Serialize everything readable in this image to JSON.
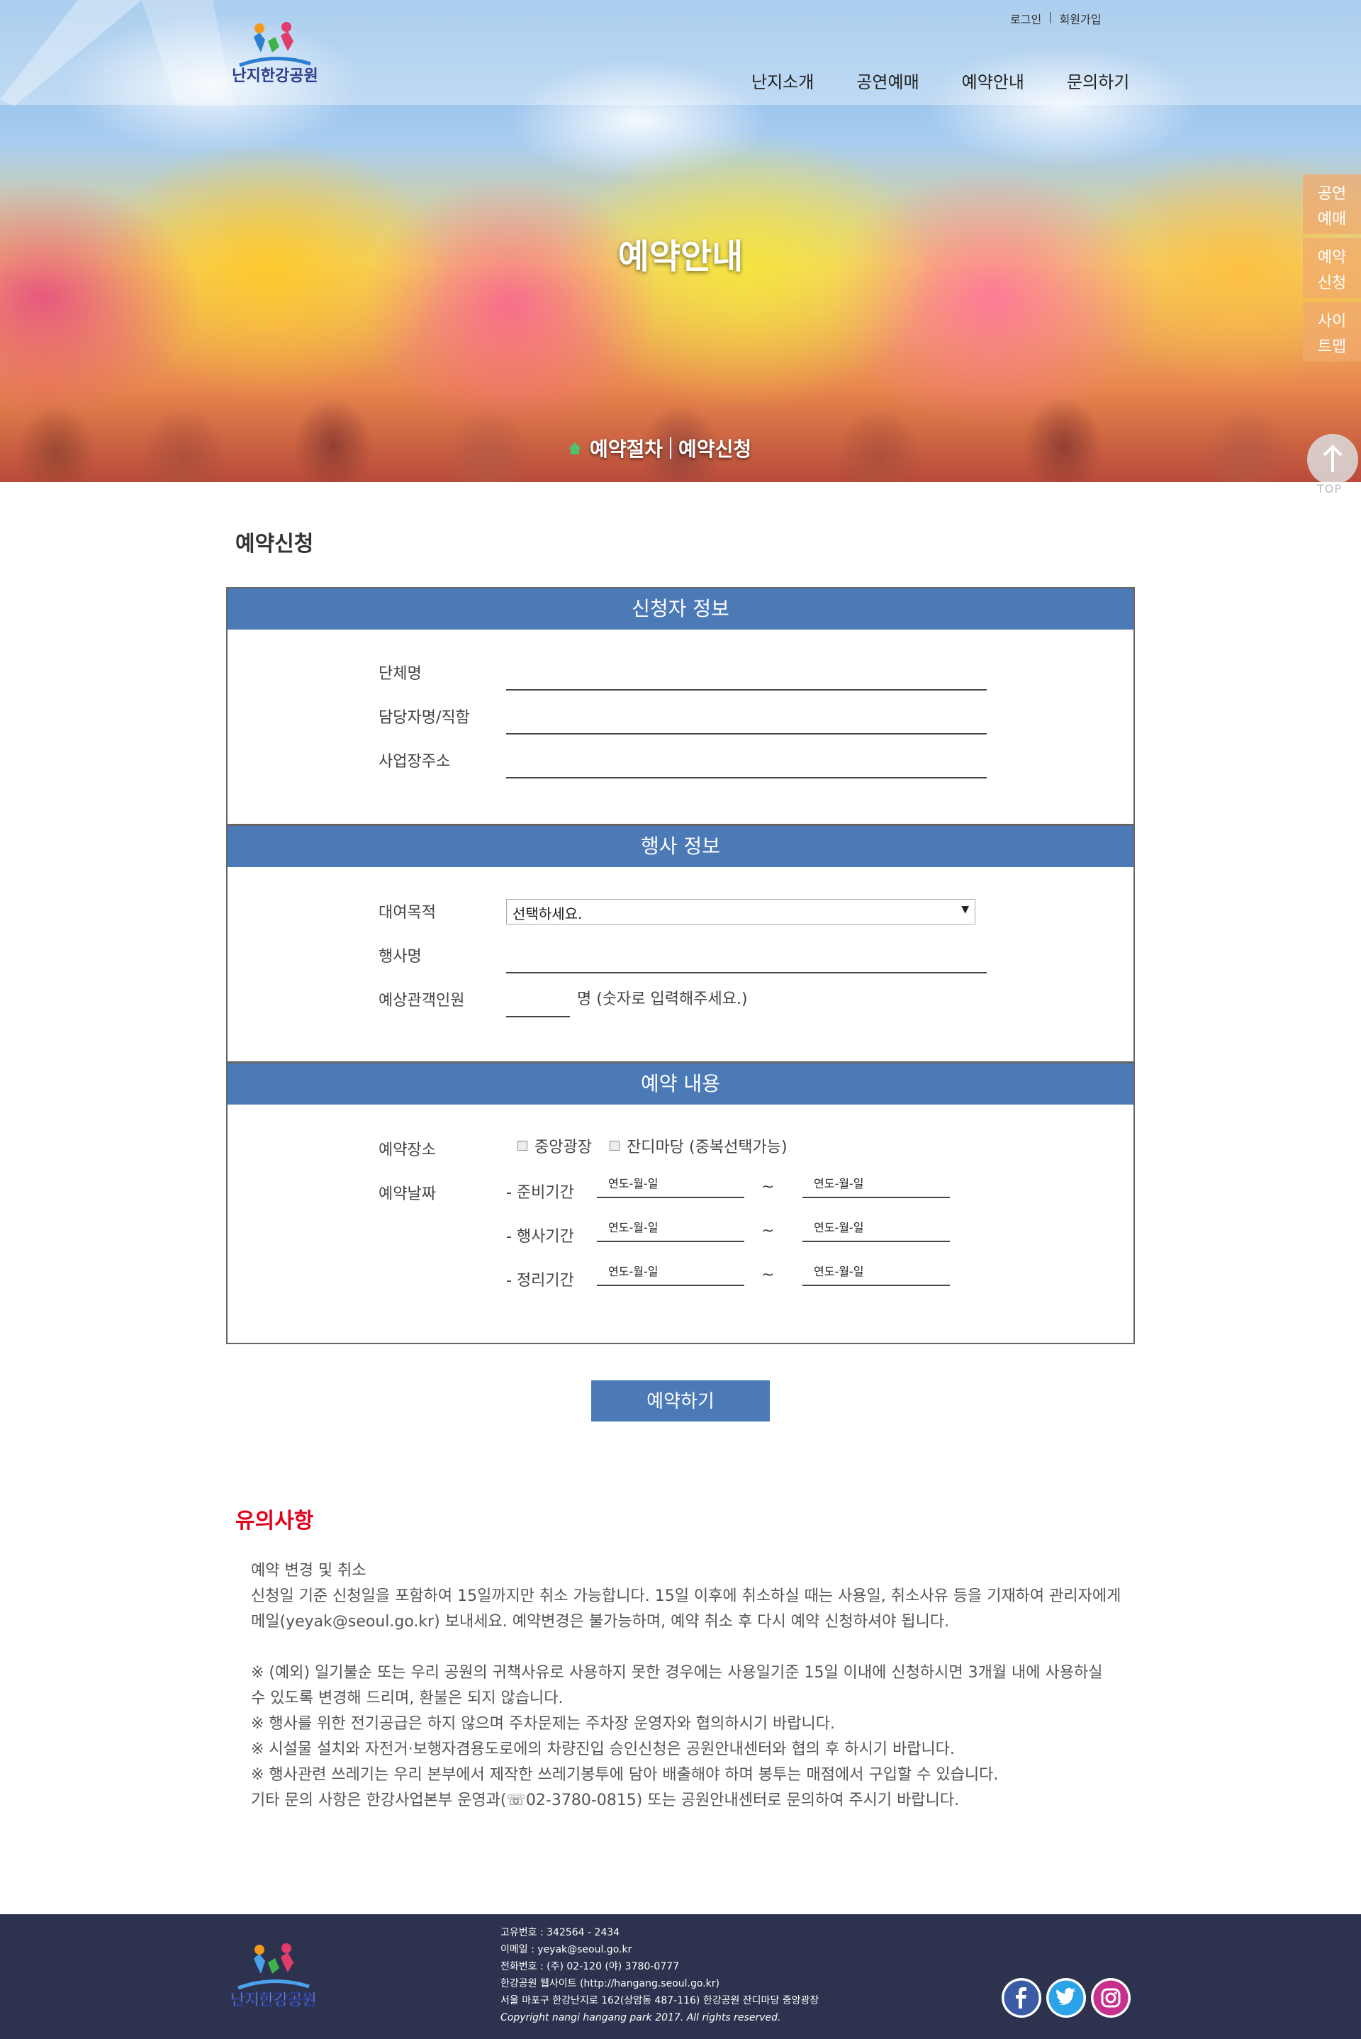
{
  "header": {
    "logo_alt": "난지한강공원",
    "util": {
      "login": "로그인",
      "sep": "|",
      "signup": "회원가입"
    },
    "nav": [
      "난지소개",
      "공연예매",
      "예약안내",
      "문의하기"
    ],
    "hero_title": "예약안내",
    "sub_tabs": {
      "first": "예약절차",
      "second": "예약신청"
    },
    "quick_links": [
      {
        "line1": "공연",
        "line2": "예매"
      },
      {
        "line1": "예약",
        "line2": "신청"
      },
      {
        "line1": "사이",
        "line2": "트맵"
      }
    ],
    "top_label": "TOP"
  },
  "page": {
    "heading": "예약신청",
    "sections": {
      "applicant": {
        "title": "신청자 정보",
        "fields": [
          "단체명",
          "담당자명/직함",
          "사업장주소"
        ]
      },
      "event": {
        "title": "행사 정보",
        "purpose_label": "대여목적",
        "purpose_value": "선택하세요.",
        "name_label": "행사명",
        "audience_label": "예상관객인원",
        "audience_suffix": "명 (숫자로 입력해주세요.)"
      },
      "reservation": {
        "title": "예약 내용",
        "place_label": "예약장소",
        "place_options": [
          "중앙광장",
          "잔디마당 (중복선택가능)"
        ],
        "date_label": "예약날짜",
        "periods": [
          "- 준비기간",
          "- 행사기간",
          "- 정리기간"
        ],
        "date_placeholder": "연도-월-일",
        "tilde": "~"
      }
    },
    "submit": "예약하기"
  },
  "notice": {
    "title": "유의사항",
    "lines": [
      "예약 변경 및 취소",
      "신청일 기준 신청일을 포함하여 15일까지만 취소 가능합니다. 15일 이후에 취소하실 때는 사용일, 취소사유 등을 기재하여 관리자에게",
      "메일(yeyak@seoul.go.kr) 보내세요. 예약변경은 불가능하며, 예약 취소 후 다시 예약 신청하셔야 됩니다.",
      "",
      "※ (예외) 일기불순 또는 우리 공원의 귀책사유로 사용하지 못한 경우에는 사용일기준 15일 이내에 신청하시면 3개월 내에 사용하실",
      "수 있도록 변경해 드리며, 환불은 되지 않습니다.",
      "※ 행사를 위한 전기공급은 하지 않으며 주차문제는 주차장 운영자와 협의하시기 바랍니다.",
      "※ 시설물 설치와 자전거·보행자겸용도로에의 차량진입 승인신청은 공원안내센터와 협의 후 하시기 바랍니다.",
      "※ 행사관련 쓰레기는 우리 본부에서 제작한 쓰레기봉투에 담아 배출해야 하며 봉투는 매점에서 구입할 수 있습니다.",
      "기타 문의 사항은 한강사업본부 운영과(☏02-3780-0815) 또는 공원안내센터로 문의하여 주시기 바랍니다."
    ]
  },
  "footer": {
    "info": [
      "고유번호 : 342564 - 2434",
      "이메일 : yeyak@seoul.go.kr",
      "전화번호 : (주) 02-120 (야) 3780-0777",
      "한강공원 웹사이트 (http://hangang.seoul.go.kr)",
      "서울 마포구 한강난지로 162(상암동 487-116) 한강공원 잔디마당 중앙광장"
    ],
    "copyright": "Copyright nangi hangang park 2017. All rights reserved.",
    "social": [
      "facebook-icon",
      "twitter-icon",
      "instagram-icon"
    ]
  }
}
